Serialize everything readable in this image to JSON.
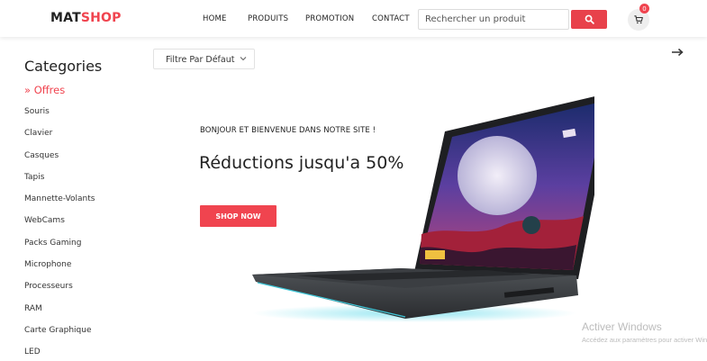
{
  "brand": {
    "part1": "MAT",
    "part2": "SHOP"
  },
  "nav": {
    "home": "HOME",
    "produits": "PRODUITS",
    "promotion": "PROMOTION",
    "contact": "CONTACT"
  },
  "search": {
    "placeholder": "Rechercher un produit"
  },
  "cart": {
    "count": "0",
    "icon": "cart-icon"
  },
  "sidebar": {
    "title": "Categories",
    "offres": "» Offres",
    "items": [
      "Souris",
      "Clavier",
      "Casques",
      "Tapis",
      "Mannette-Volants",
      "WebCams",
      "Packs Gaming",
      "Microphone",
      "Processeurs",
      "RAM",
      "Carte Graphique",
      "LED"
    ]
  },
  "filter": {
    "selected": "Filtre Par Défaut"
  },
  "hero": {
    "welcome": "BONJOUR ET BIENVENUE DANS NOTRE SITE !",
    "headline": "Réductions jusqu'a 50%",
    "button": "SHOP NOW"
  },
  "watermark": {
    "title": "Activer Windows",
    "subtitle": "Accédez aux paramètres pour activer Windows."
  },
  "colors": {
    "accent": "#f0444f",
    "button": "#e8414b"
  }
}
